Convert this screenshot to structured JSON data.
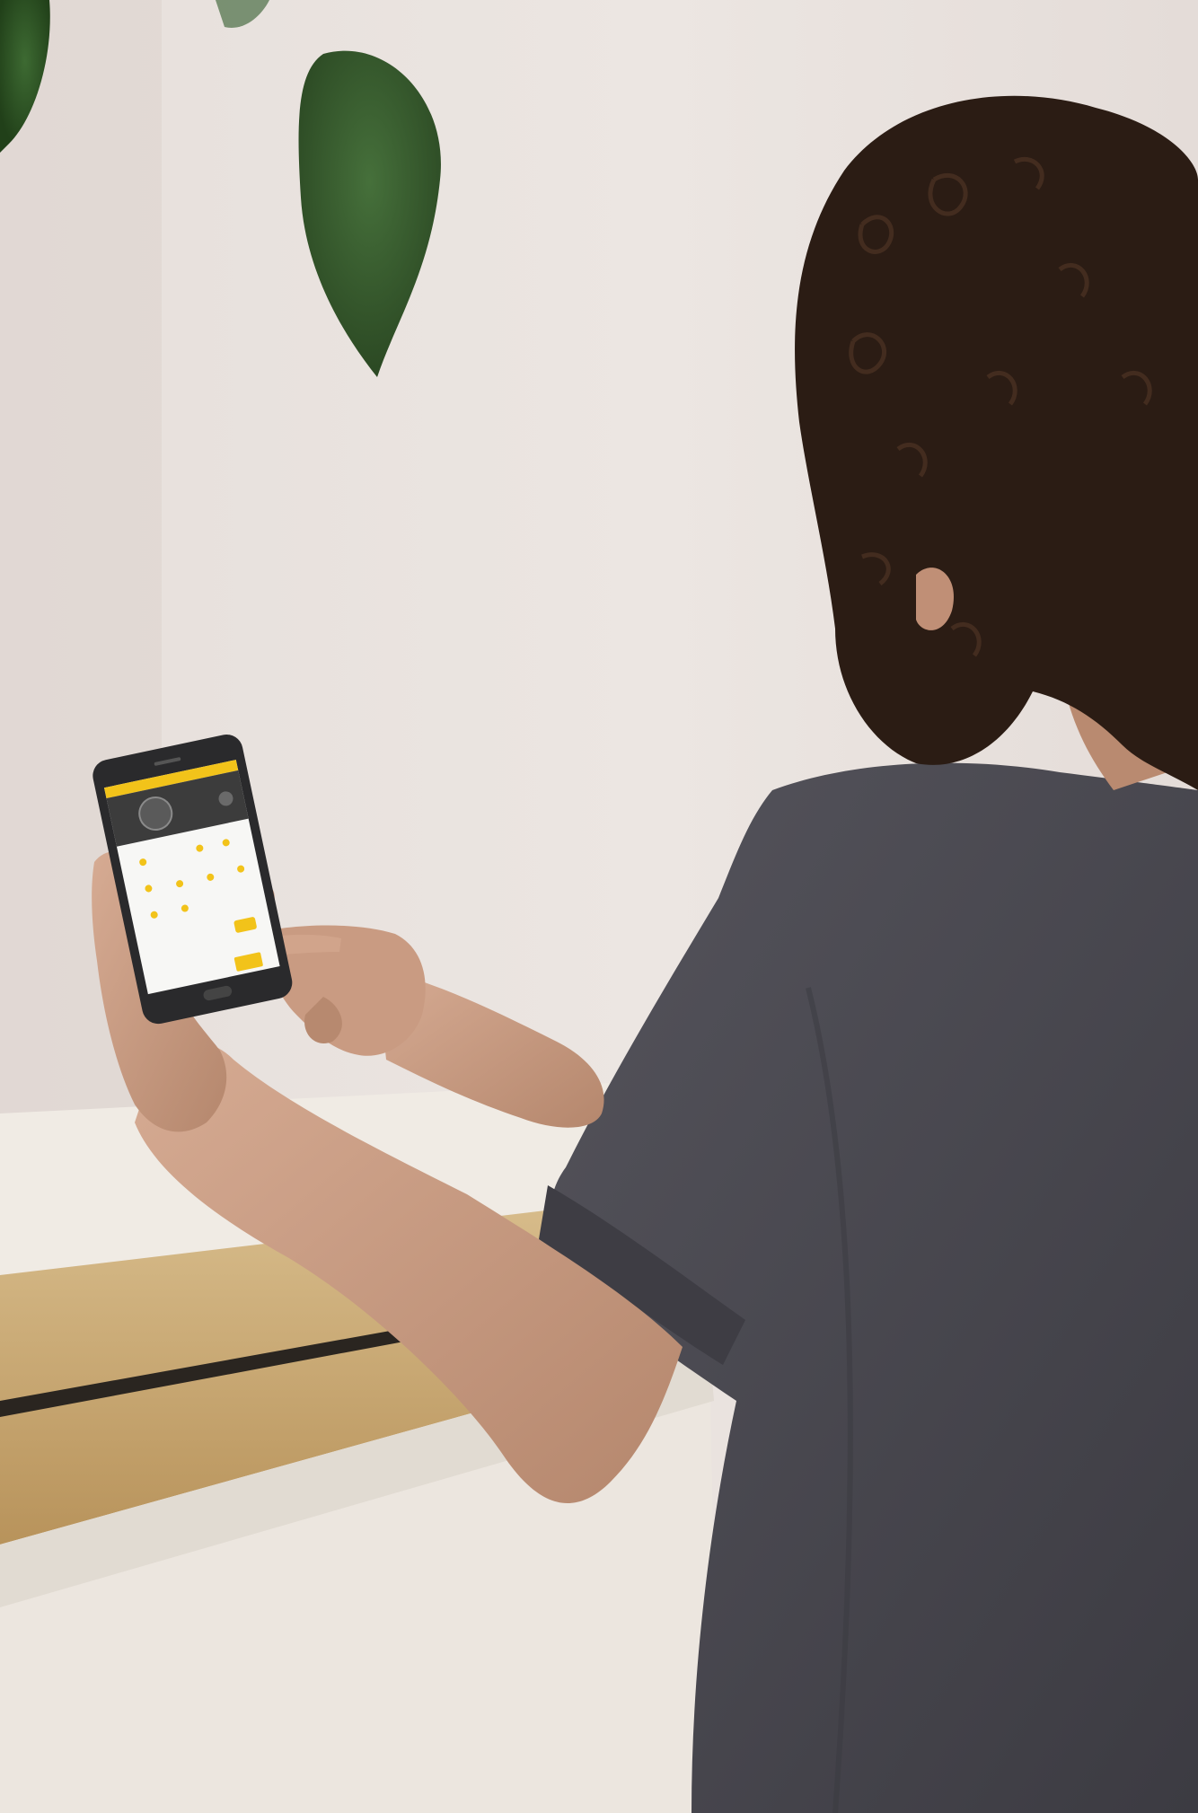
{
  "scene": {
    "subject": "person-using-smartphone-app",
    "colors": {
      "wall": "#e9e2de",
      "wall_shadow": "#d9d0cb",
      "leaf": "#2f5a2a",
      "wood": "#c9a571",
      "wood_dark": "#a8854f",
      "counter_front": "#ece6df",
      "shirt": "#4b4a52",
      "shirt_dark": "#3a3940",
      "hair": "#2b1c14",
      "skin": "#c89a80",
      "skin_shadow": "#a87a62",
      "phone_body": "#2a2a2c",
      "app_accent": "#f2c31a",
      "app_header": "#3c3c3c",
      "app_screen": "#f7f7f5"
    }
  },
  "phone": {
    "icons": [
      "lock-icon",
      "settings-icon"
    ]
  }
}
